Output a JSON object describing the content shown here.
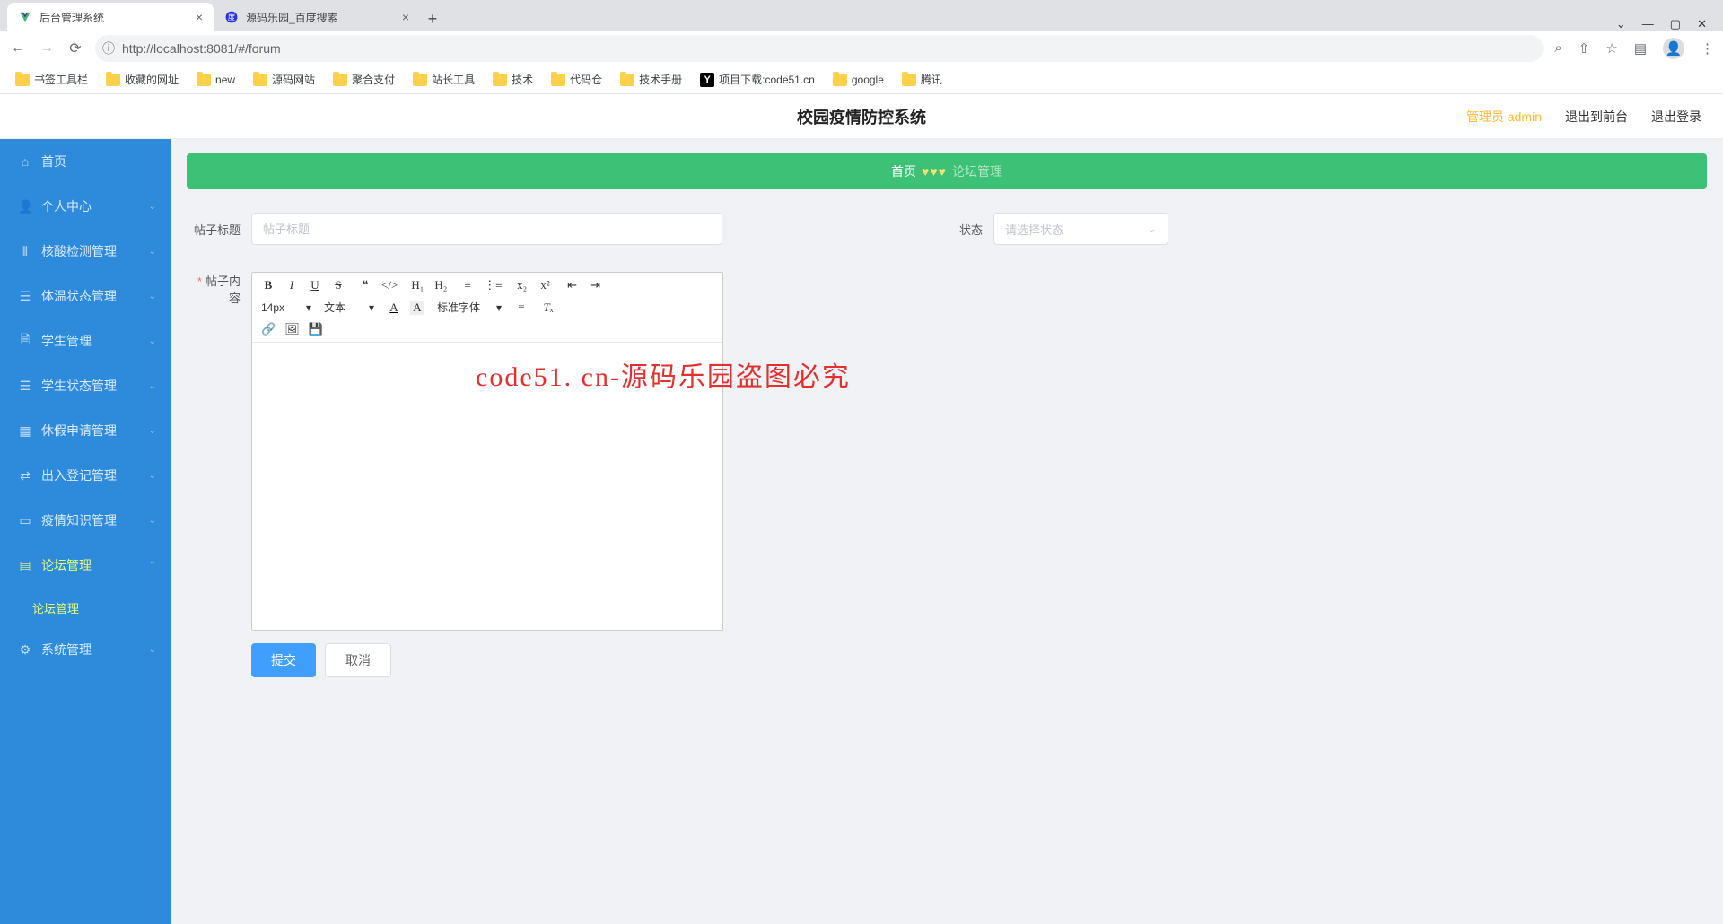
{
  "browser": {
    "tabs": [
      {
        "title": "后台管理系统",
        "active": true
      },
      {
        "title": "源码乐园_百度搜索",
        "active": false
      }
    ],
    "url": "http://localhost:8081/#/forum",
    "bookmarks": [
      "书签工具栏",
      "收藏的网址",
      "new",
      "源码网站",
      "聚合支付",
      "站长工具",
      "技术",
      "代码仓",
      "技术手册",
      "项目下载:code51.cn",
      "google",
      "腾讯"
    ]
  },
  "header": {
    "title": "校园疫情防控系统",
    "admin": "管理员 admin",
    "logout_front": "退出到前台",
    "logout": "退出登录"
  },
  "sidebar": [
    {
      "icon": "home",
      "label": "首页"
    },
    {
      "icon": "user",
      "label": "个人中心",
      "chev": "down"
    },
    {
      "icon": "bars",
      "label": "核酸检测管理",
      "chev": "down"
    },
    {
      "icon": "list",
      "label": "体温状态管理",
      "chev": "down"
    },
    {
      "icon": "doc",
      "label": "学生管理",
      "chev": "down"
    },
    {
      "icon": "list",
      "label": "学生状态管理",
      "chev": "down"
    },
    {
      "icon": "calendar",
      "label": "休假申请管理",
      "chev": "down"
    },
    {
      "icon": "inout",
      "label": "出入登记管理",
      "chev": "down"
    },
    {
      "icon": "book",
      "label": "疫情知识管理",
      "chev": "down"
    },
    {
      "icon": "forum",
      "label": "论坛管理",
      "chev": "up",
      "active": true,
      "sub": "论坛管理"
    },
    {
      "icon": "gear",
      "label": "系统管理",
      "chev": "down"
    }
  ],
  "breadcrumb": {
    "home": "首页",
    "current": "论坛管理"
  },
  "form": {
    "title_label": "帖子标题",
    "title_placeholder": "帖子标题",
    "status_label": "状态",
    "status_placeholder": "请选择状态",
    "content_label": "帖子内容",
    "toolbar": {
      "font_size": "14px",
      "text_type": "文本",
      "font_family": "标准字体"
    },
    "submit": "提交",
    "cancel": "取消"
  },
  "watermark": "code51. cn-源码乐园盗图必究"
}
